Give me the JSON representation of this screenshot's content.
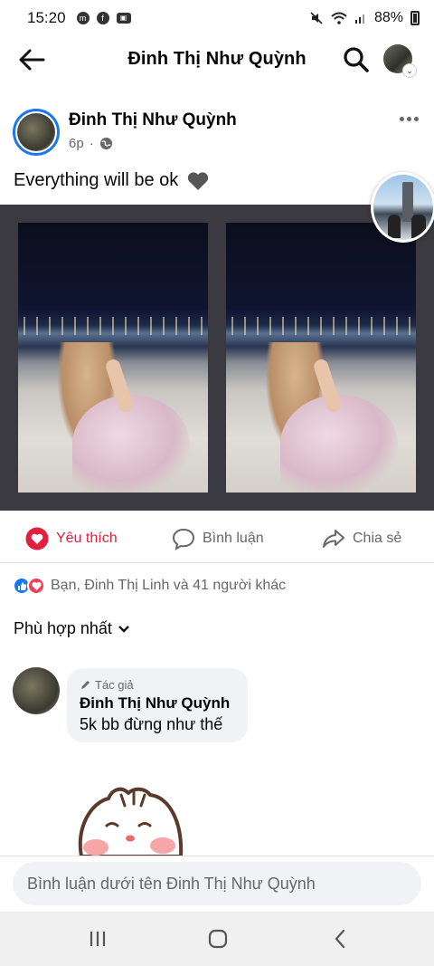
{
  "status_bar": {
    "time": "15:20",
    "battery": "88%",
    "notif_icons": [
      "messenger-icon",
      "facebook-icon",
      "gallery-icon"
    ],
    "sys_icons": [
      "mute-icon",
      "wifi-icon",
      "signal-icon",
      "battery-icon"
    ]
  },
  "header": {
    "title": "Đinh Thị Như Quỳnh"
  },
  "post": {
    "author": "Đinh Thị Như Quỳnh",
    "time": "6p",
    "separator": "·",
    "privacy": "globe-icon",
    "text": "Everything will be ok"
  },
  "actions": {
    "like": "Yêu thích",
    "comment": "Bình luận",
    "share": "Chia sẻ"
  },
  "reactions": {
    "summary": "Bạn, Đinh Thị Linh và 41 người khác"
  },
  "sort": {
    "label": "Phù hợp nhất"
  },
  "comment": {
    "badge": "Tác giả",
    "author": "Đinh Thị Như Quỳnh",
    "text": "5k bb đừng như thế"
  },
  "composer": {
    "placeholder": "Bình luận dưới tên Đinh Thị Như Quỳnh"
  },
  "colors": {
    "accent": "#1877f2",
    "love": "#e41e3f",
    "secondary_text": "#65676b",
    "bubble_bg": "#f0f2f5"
  }
}
